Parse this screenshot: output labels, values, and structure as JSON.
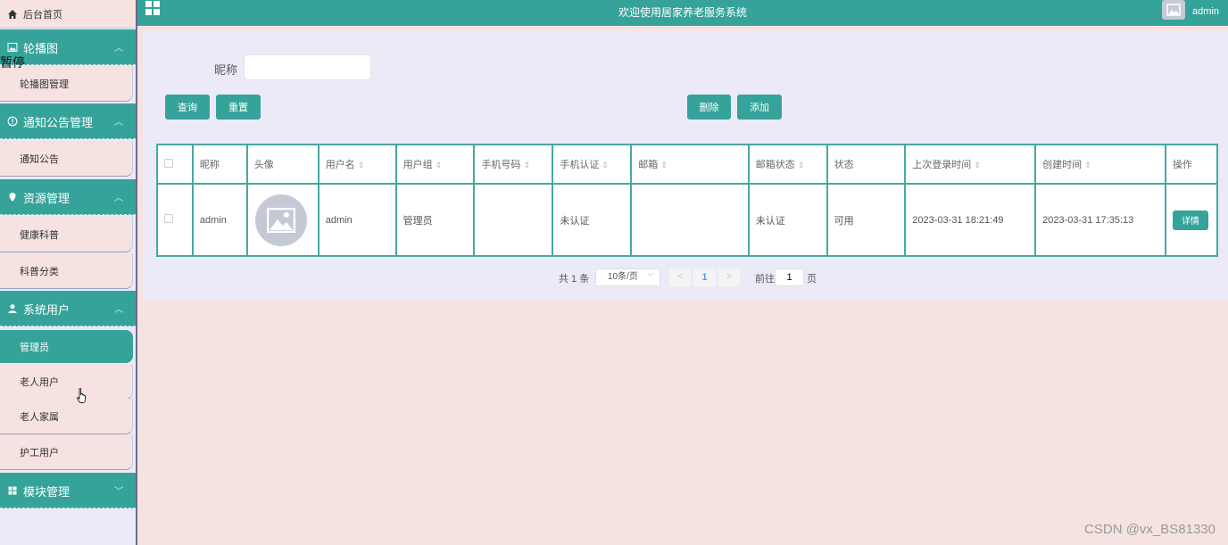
{
  "header": {
    "title": "欢迎使用居家养老服务系统",
    "user": "admin"
  },
  "sidebar": {
    "home": "后台首页",
    "stray_text": "暂停",
    "groups": [
      {
        "label": "轮播图",
        "icon": "image-icon",
        "items": [
          "轮播图管理"
        ]
      },
      {
        "label": "通知公告管理",
        "icon": "info-icon",
        "items": [
          "通知公告"
        ]
      },
      {
        "label": "资源管理",
        "icon": "location-icon",
        "items": [
          "健康科普",
          "科普分类"
        ]
      },
      {
        "label": "系统用户",
        "icon": "user-icon",
        "items": [
          "管理员",
          "老人用户",
          "老人家属",
          "护工用户"
        ]
      },
      {
        "label": "模块管理",
        "icon": "grid-icon",
        "items": []
      }
    ],
    "active_item": "管理员"
  },
  "search": {
    "label": "昵称",
    "value": "",
    "placeholder": ""
  },
  "buttons": {
    "query": "查询",
    "reset": "重置",
    "delete": "删除",
    "add": "添加"
  },
  "table": {
    "columns": [
      "昵称",
      "头像",
      "用户名",
      "用户组",
      "手机号码",
      "手机认证",
      "邮箱",
      "邮箱状态",
      "状态",
      "上次登录时间",
      "创建时间",
      "操作"
    ],
    "rows": [
      {
        "nickname": "admin",
        "username": "admin",
        "group": "管理员",
        "phone": "",
        "phone_verified": "未认证",
        "email": "",
        "email_status": "未认证",
        "status": "可用",
        "last_login": "2023-03-31 18:21:49",
        "created": "2023-03-31 17:35:13",
        "action": "详情"
      }
    ]
  },
  "pagination": {
    "total": "共 1 条",
    "page_size": "10条/页",
    "current": "1",
    "goto_label": "前往",
    "goto_value": "1",
    "page_suffix": "页"
  },
  "watermark": "CSDN @vx_BS81330",
  "colors": {
    "accent": "#36a39b",
    "sidebar_item_bg": "#f5e2e1",
    "panel_bg": "#eceaf7",
    "page_bg": "#f5e3e1"
  }
}
